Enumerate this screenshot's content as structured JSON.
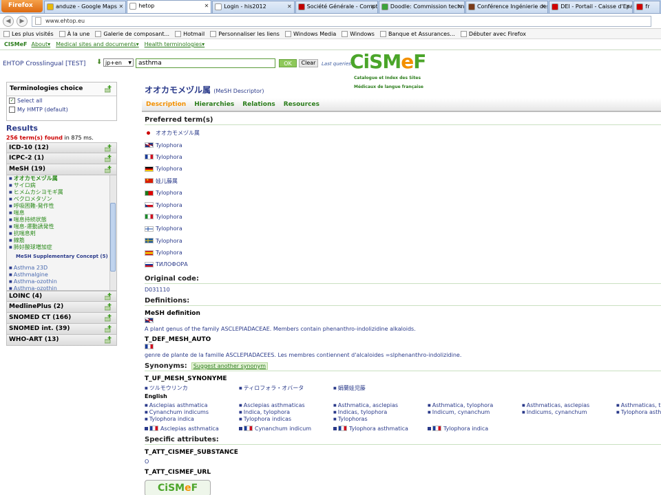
{
  "browser": {
    "app_button": "Firefox",
    "tabs": [
      {
        "label": "anduze - Google Maps",
        "color": "#e8b80a",
        "active": false
      },
      {
        "label": "hetop",
        "color": "#ffffff",
        "active": true
      },
      {
        "label": "Login - his2012",
        "color": "#ffffff",
        "active": false
      },
      {
        "label": "Société Générale - Comptes ...",
        "color": "#c00000",
        "active": false
      },
      {
        "label": "Doodle: Commission techno",
        "color": "#3ca33c",
        "active": false
      },
      {
        "label": "Conférence Ingénierie des C...",
        "color": "#7a3b1a",
        "active": false
      },
      {
        "label": "DEI - Portail - Caisse d'Epargn...",
        "color": "#d00000",
        "active": false
      },
      {
        "label": "fr",
        "color": "#d00000",
        "active": false
      }
    ],
    "url": "www.ehtop.eu",
    "bookmarks": [
      "Les plus visités",
      "À la une",
      "Galerie de composant...",
      "Hotmail",
      "Personnaliser les liens",
      "Windows Media",
      "Windows",
      "Banque et Assurances...",
      "Débuter avec Firefox"
    ]
  },
  "sitenav": {
    "logo": "CISMeF",
    "links": [
      "About▾",
      "Medical sites and documents▾",
      "Health terminologies▾"
    ]
  },
  "header": {
    "crossling": "EHTOP Crosslingual [TEST]",
    "lang": "jp+en",
    "query": "asthma",
    "ok": "OK",
    "clear": "Clear",
    "last_queries": "Last queries",
    "logo_text": "CiSMeF",
    "logo_sub1": "Catalogue et Index des Sites",
    "logo_sub2": "Médicaux de langue française"
  },
  "sidebar": {
    "choice_title": "Terminologies choice",
    "select_all": "Select all",
    "my_hmtp": "My HMTP (default)",
    "results_title": "Results",
    "found_count": "256 term(s) found",
    "found_time": "in 875 ms.",
    "terms_top": [
      {
        "label": "ICD-10 (12)"
      },
      {
        "label": "ICPC-2 (1)"
      },
      {
        "label": "MeSH (19)"
      }
    ],
    "mesh_items": [
      "オオカモメヅル属",
      "サイロ病",
      "ヒメムカシヨモギ属",
      "ベクロメタゾン",
      "呼吸困難-発作性",
      "喘息",
      "喘息持続状態",
      "喘息-運動誘発性",
      "抗喘息剤",
      "線筋",
      "肺好酸球増加症"
    ],
    "mesh_supp": "MeSH Supplementary Concept (5)",
    "mesh_supp_items": [
      "Asthma 23D",
      "Asthmalgine",
      "Asthma-ozothin",
      "Asthma-ozothin"
    ],
    "terms_bottom": [
      {
        "label": "LOINC (4)"
      },
      {
        "label": "MedlinePlus (2)"
      },
      {
        "label": "SNOMED CT (166)"
      },
      {
        "label": "SNOMED int. (39)"
      },
      {
        "label": "WHO-ART (13)"
      }
    ]
  },
  "main": {
    "title": "オオカモメヅル属",
    "title_type": "(MeSH Descriptor)",
    "tabs": [
      "Description",
      "Hierarchies",
      "Relations",
      "Resources"
    ],
    "preferred_title": "Preferred term(s)",
    "preferred": [
      {
        "flag": "jp",
        "text": "オオカモメヅル属"
      },
      {
        "flag": "gb",
        "text": "Tylophora"
      },
      {
        "flag": "fr",
        "text": "Tylophora"
      },
      {
        "flag": "de",
        "text": "Tylophora"
      },
      {
        "flag": "cn",
        "text": "娃儿藤属"
      },
      {
        "flag": "pt",
        "text": "Tylophora"
      },
      {
        "flag": "cz",
        "text": "Tylophora"
      },
      {
        "flag": "it",
        "text": "Tylophora"
      },
      {
        "flag": "fi",
        "text": "Tylophora"
      },
      {
        "flag": "se",
        "text": "Tylophora"
      },
      {
        "flag": "es",
        "text": "Tylophora"
      },
      {
        "flag": "ru",
        "text": "ТИЛОФОРА"
      }
    ],
    "original_code_title": "Original code:",
    "original_code": "D031110",
    "definitions_title": "Definitions:",
    "mesh_def_title": "MeSH definition",
    "mesh_def_text": "A plant genus of the family ASCLEPIADACEAE. Members contain phenanthro-indolizidine alkaloids.",
    "def_auto_title": "T_DEF_MESH_AUTO",
    "def_auto_text": "genre de plante de la famille ASCLEPIADACEES. Les membres contiennent d'alcaloides =slphenanthro-indolizidine.",
    "synonyms_title": "Synonyms:",
    "suggest": "Suggest another synonym",
    "uf_title": "T_UF_MESH_SYNONYME",
    "jp_syn": [
      "ツルモウリンカ",
      "ティロフォラ・オバータ",
      "娟蘭娃児藤"
    ],
    "english": "English",
    "en_syn": [
      "Asclepias asthmatica",
      "Asclepias asthmaticas",
      "Asthmatica, asclepias",
      "Asthmatica, tylophora",
      "Asthmaticas, asclepias",
      "Asthmaticas, tylo",
      "Cynanchum indicums",
      "Indica, tylophora",
      "Indicas, tylophora",
      "Indicum, cynanchum",
      "Indicums, cynanchum",
      "Tylophora asthm",
      "Tylophora indica",
      "Tylophora indicas",
      "Tylophoras"
    ],
    "fr_syn": [
      "Asclepias asthmatica",
      "Cynanchum indicum",
      "Tylophora asthmatica",
      "Tylophora indica"
    ],
    "specific_title": "Specific attributes:",
    "att_sub_title": "T_ATT_CISMEF_SUBSTANCE",
    "att_sub_val": "O",
    "att_url_title": "T_ATT_CISMEF_URL",
    "small_logo": "CiSMeF"
  }
}
